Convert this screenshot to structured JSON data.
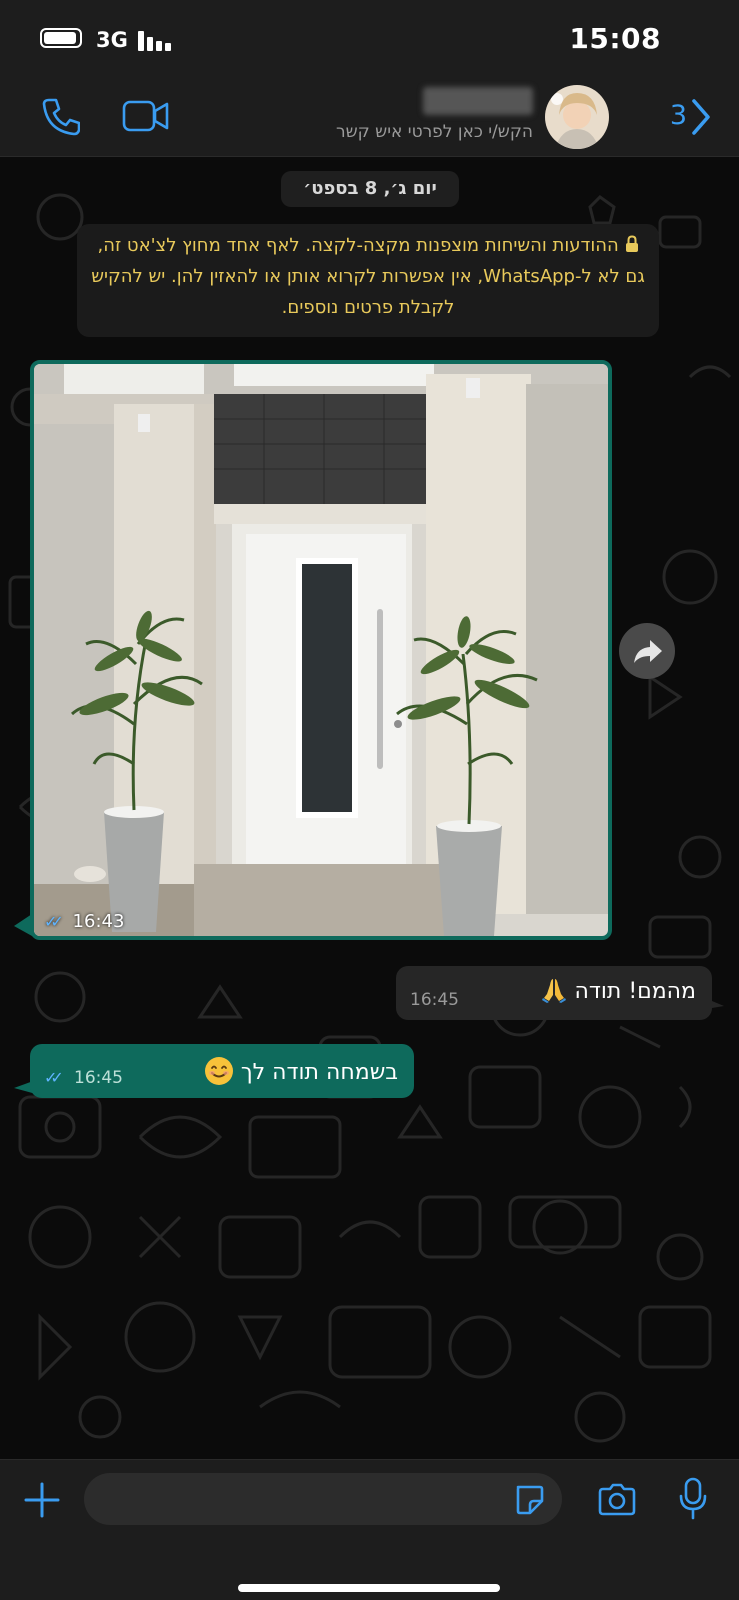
{
  "status_bar": {
    "network": "3G",
    "time": "15:08"
  },
  "header": {
    "back_count": "3",
    "contact_subtitle": "הקש/י כאן לפרטי איש קשר"
  },
  "date_separator": "יום ג׳, 8 בספט׳",
  "encryption_notice": "ההודעות והשיחות מוצפנות מקצה-לקצה. לאף אחד מחוץ לצ'אט זה, גם לא ל-WhatsApp, אין אפשרות לקרוא אותן או להאזין להן. יש להקיש לקבלת פרטים נוספים.",
  "messages": [
    {
      "type": "image",
      "direction": "outgoing",
      "time": "16:43",
      "status": "read"
    },
    {
      "type": "text",
      "direction": "incoming",
      "text": "מהמם! תודה",
      "emoji": "folded-hands",
      "time": "16:45"
    },
    {
      "type": "text",
      "direction": "outgoing",
      "text": "בשמחה תודה לך",
      "emoji": "smiling-face",
      "time": "16:45",
      "status": "read"
    }
  ],
  "composer": {
    "placeholder": ""
  },
  "colors": {
    "accent": "#3a9cf0",
    "outgoing_bubble": "#0e6a5c",
    "incoming_bubble": "#262626",
    "notice_text": "#e8c95b"
  }
}
